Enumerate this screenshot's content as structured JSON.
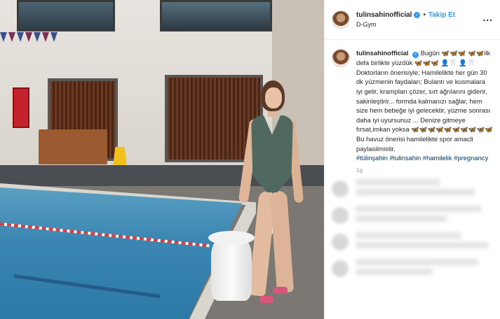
{
  "post": {
    "username": "tulinsahinofficial",
    "follow_label": "Takip Et",
    "separator": "•",
    "location": "D-Gym",
    "more_label": "...",
    "caption": {
      "username": "tulinsahinofficial",
      "text": "Bugün 🦋🦋🦋 🦋🦋ilk defa birlikte yüzdük 🦋🦋🦋 👤🦷 👤🦷 Doktorların önerisiyle; Hamilelikte her gün 30 dk yüzmenin faydaları; Bulantı ve kusmalara iyi gelir, krampları çözer, sırt ağrılarını giderir, sakinleştirir... formda kalmanızı sağlar, hem size hem bebeğe iyi gelecektir, yüzme sonrası daha iyi uyursunuz ... Denize gitmeye fırsat,imkan yoksa 🦋🦋🦋🦋🦋🦋🦋🦋🦋🦋Bu havuz önerisi hamilelikte spor amacli paylasilmistir.",
      "hashtags": [
        "#tülinşahin",
        "#tulinsahin",
        "#hamilelik",
        "#pregnancy"
      ]
    },
    "time_label": "1g"
  },
  "icons": {
    "verified": "verified-badge-icon",
    "more": "more-options-icon"
  },
  "colors": {
    "link_blue": "#3897f0",
    "hashtag": "#003569",
    "border": "#efefef"
  }
}
